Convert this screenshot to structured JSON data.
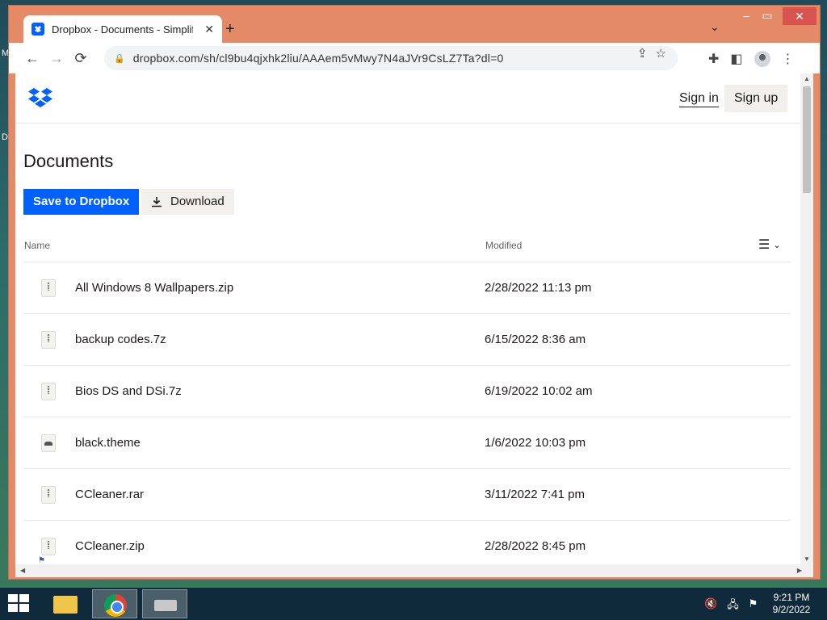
{
  "desktop": {
    "side_letters": [
      "M",
      "D"
    ]
  },
  "browser": {
    "tab_title": "Dropbox - Documents - Simplify",
    "tab_close": "✕",
    "new_tab": "+",
    "url": "dropbox.com/sh/cl9bu4qjxhk2liu/AAAem5vMwy7N4aJVr9CsLZ7Ta?dl=0",
    "nav": {
      "back": "←",
      "forward": "→",
      "reload": "⟳"
    }
  },
  "page": {
    "header": {
      "sign_in": "Sign in",
      "sign_up": "Sign up"
    },
    "title": "Documents",
    "buttons": {
      "save": "Save to Dropbox",
      "download": "Download"
    },
    "columns": {
      "name": "Name",
      "modified": "Modified"
    },
    "files": [
      {
        "name": "All Windows 8 Wallpapers.zip",
        "modified": "2/28/2022 11:13 pm",
        "icon": "zip-file-icon"
      },
      {
        "name": "backup codes.7z",
        "modified": "6/15/2022 8:36 am",
        "icon": "zip-file-icon"
      },
      {
        "name": "Bios DS and DSi.7z",
        "modified": "6/19/2022 10:02 am",
        "icon": "zip-file-icon"
      },
      {
        "name": "black.theme",
        "modified": "1/6/2022 10:03 pm",
        "icon": "theme-file-icon"
      },
      {
        "name": "CCleaner.rar",
        "modified": "3/11/2022 7:41 pm",
        "icon": "zip-file-icon"
      },
      {
        "name": "CCleaner.zip",
        "modified": "2/28/2022 8:45 pm",
        "icon": "zip-file-icon"
      }
    ]
  },
  "taskbar": {
    "time": "9:21 PM",
    "date": "9/2/2022"
  },
  "colors": {
    "accent": "#0061fe",
    "window_frame": "#e58a66"
  }
}
